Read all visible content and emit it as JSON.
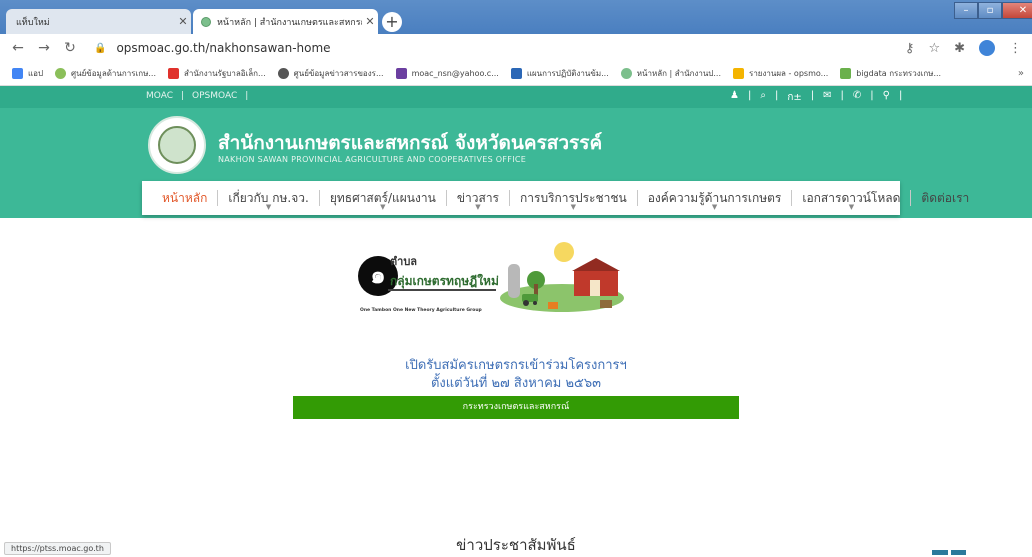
{
  "browser": {
    "tabs": [
      {
        "label": "แท็บใหม่"
      },
      {
        "label": "หน้าหลัก | สำนักงานเกษตรและสหกรณ์"
      }
    ],
    "url": "opsmoac.go.th/nakhonsawan-home",
    "bookmarks": [
      {
        "label": "แอป",
        "icon": "apps-icon",
        "color": "#4285f4"
      },
      {
        "label": "ศูนย์ข้อมูลด้านการเกษ...",
        "icon": "globe-icon",
        "color": "#8bbf5a"
      },
      {
        "label": "สำนักงานรัฐบาลอิเล็ก...",
        "icon": "d-logo-icon",
        "color": "#e0322c"
      },
      {
        "label": "ศูนย์ข้อมูลข่าวสารของร...",
        "icon": "globe-icon",
        "color": "#555555"
      },
      {
        "label": "moac_nsn@yahoo.c...",
        "icon": "mail-icon",
        "color": "#6b3fa0"
      },
      {
        "label": "แผนการปฏิบัติงานข้ม...",
        "icon": "doc-icon",
        "color": "#2b67b6"
      },
      {
        "label": "หน้าหลัก | สำนักงานป...",
        "icon": "globe-icon",
        "color": "#7cbf8c"
      },
      {
        "label": "รายงานผล - opsmo...",
        "icon": "sheet-icon",
        "color": "#f4b400"
      },
      {
        "label": "bigdata กระทรวงเกษ...",
        "icon": "chart-icon",
        "color": "#6ab04c"
      }
    ],
    "status_url": "https://ptss.moac.go.th"
  },
  "site": {
    "top_links": [
      "MOAC",
      "OPSMOAC"
    ],
    "org_name": "สำนักงานเกษตรและสหกรณ์ จังหวัดนครสวรรค์",
    "org_name_en": "NAKHON SAWAN PROVINCIAL AGRICULTURE AND COOPERATIVES OFFICE",
    "menu": [
      {
        "label": "หน้าหลัก",
        "active": true,
        "dropdown": false
      },
      {
        "label": "เกี่ยวกับ กษ.จว.",
        "active": false,
        "dropdown": true
      },
      {
        "label": "ยุทธศาสตร์/แผนงาน",
        "active": false,
        "dropdown": true
      },
      {
        "label": "ข่าวสาร",
        "active": false,
        "dropdown": true
      },
      {
        "label": "การบริการประชาชน",
        "active": false,
        "dropdown": true
      },
      {
        "label": "องค์ความรู้ด้านการเกษตร",
        "active": false,
        "dropdown": true
      },
      {
        "label": "เอกสารดาวน์โหลด",
        "active": false,
        "dropdown": true
      },
      {
        "label": "ติดต่อเรา",
        "active": false,
        "dropdown": false
      }
    ],
    "banner": {
      "number": "๑",
      "line1": "ตำบล",
      "line2": "กลุ่มเกษตรทฤษฎีใหม่",
      "english": "One Tambon One New Theory Agriculture Group"
    },
    "announcement_line1": "เปิดรับสมัครเกษตรกรเข้าร่วมโครงการฯ",
    "announcement_line2": "ตั้งแต่วันที่ ๒๗ สิงหาคม ๒๕๖๓",
    "ministry_bar": "กระทรวงเกษตรและสหกรณ์",
    "news_title": "ข่าวประชาสัมพันธ์"
  },
  "colors": {
    "header_green": "#3db897",
    "topbar_green": "#30ab8b",
    "menu_active": "#e2582a",
    "ministry_bar": "#339b05",
    "announce_blue": "#3f6fb6"
  }
}
